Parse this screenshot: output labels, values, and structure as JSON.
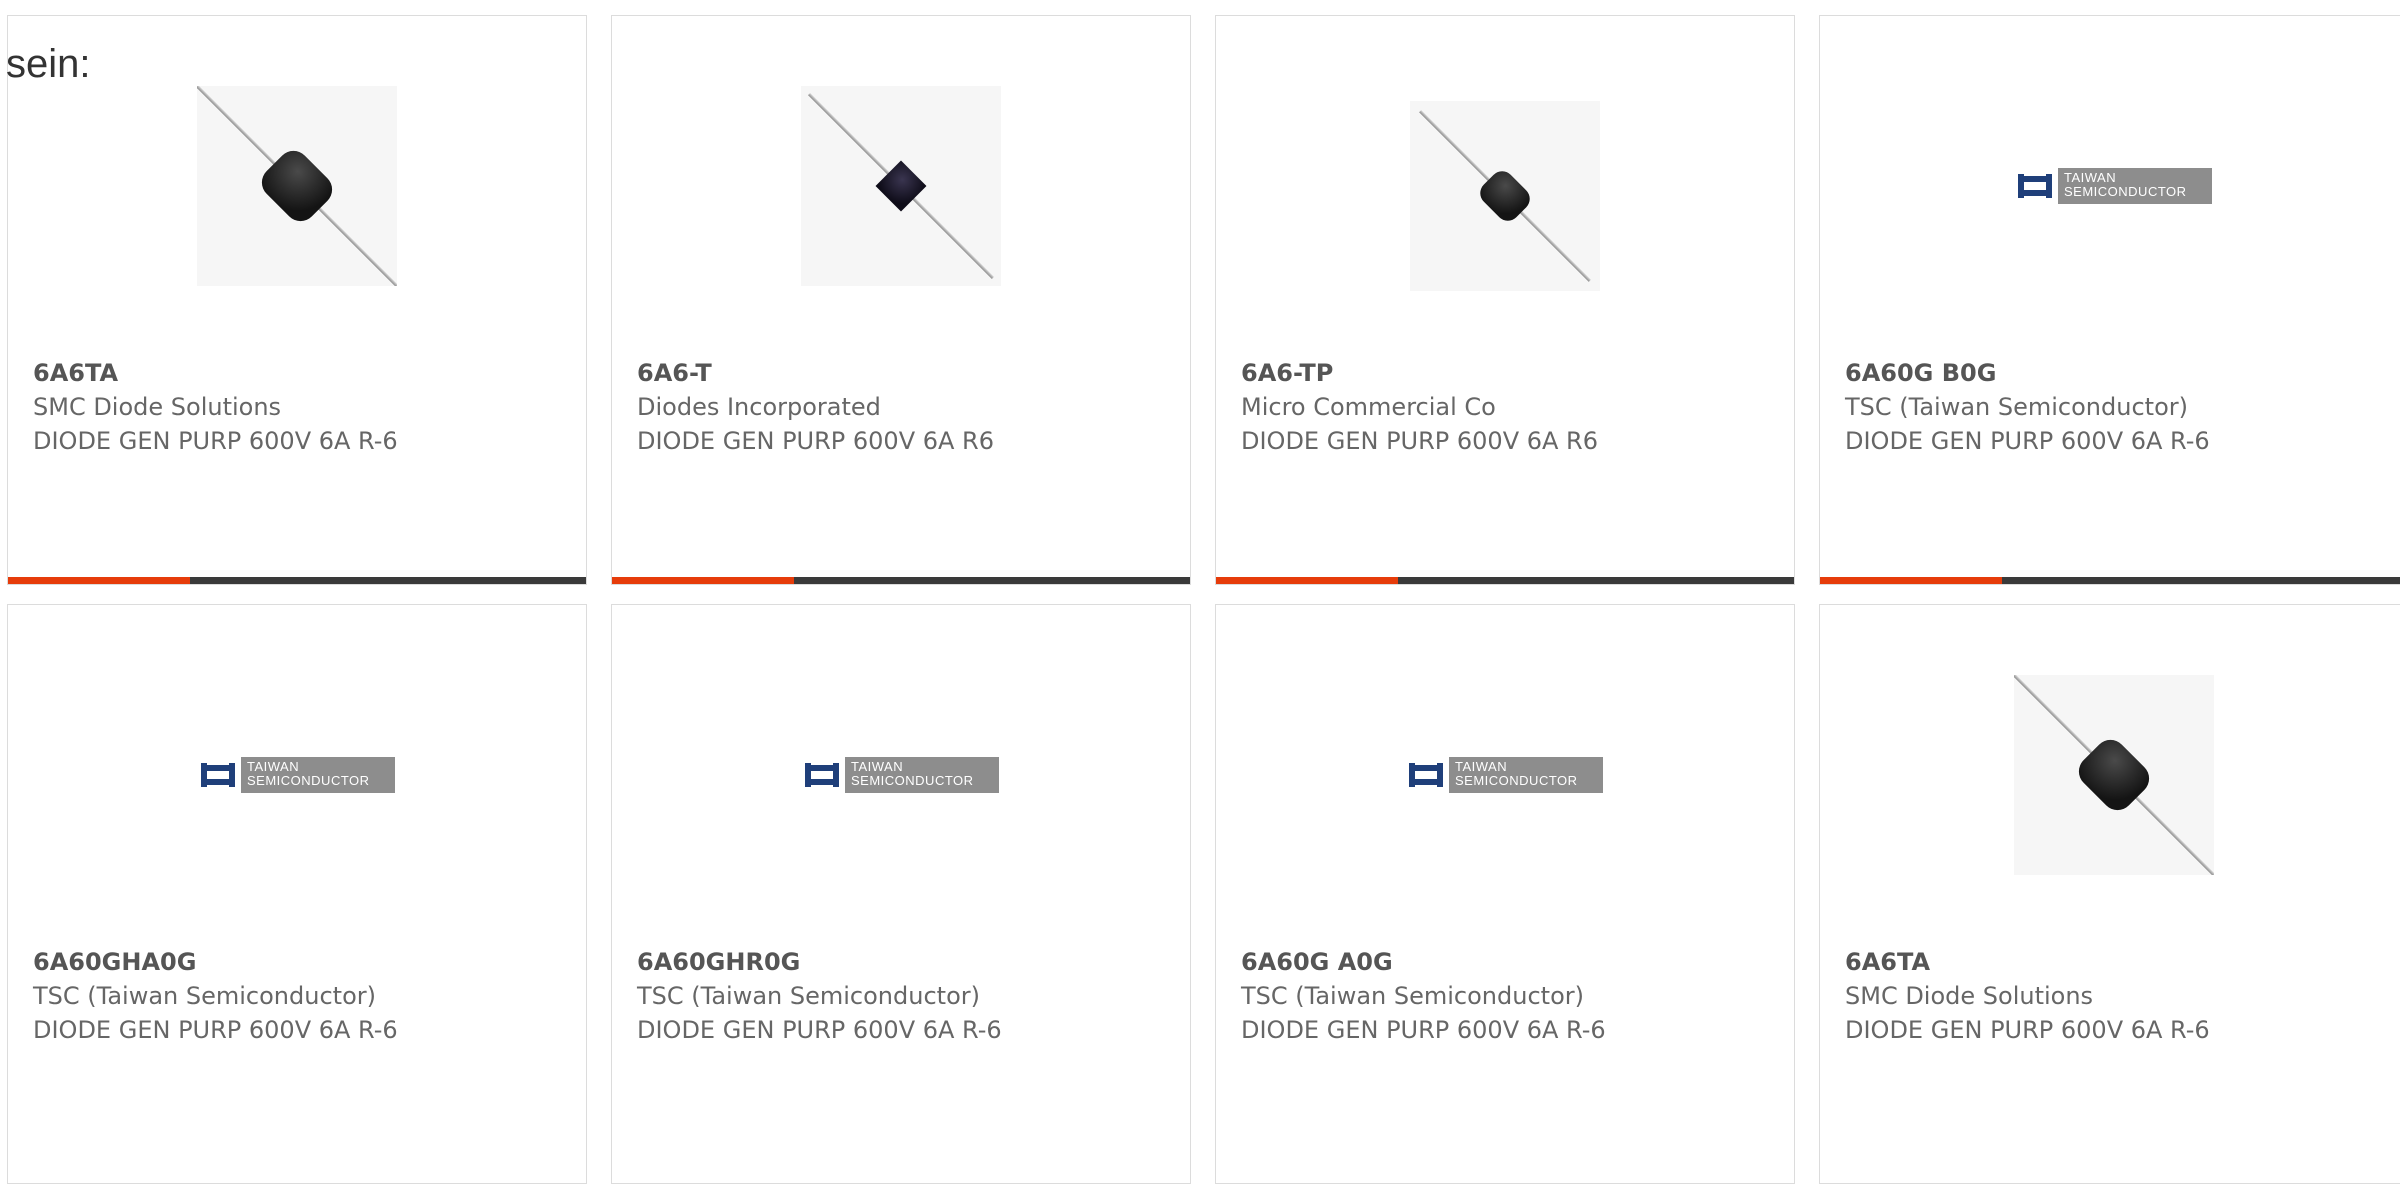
{
  "intro_text": "sein:",
  "accent_color": "#e63c0a",
  "bar_color": "#3a3a3a",
  "products": [
    {
      "part": "6A6TA",
      "manufacturer": "SMC Diode Solutions",
      "description": "DIODE GEN PURP 600V 6A R-6",
      "image": "diode-axial-black-icon"
    },
    {
      "part": "6A6-T",
      "manufacturer": "Diodes Incorporated",
      "description": "DIODE GEN PURP 600V 6A R6",
      "image": "diode-axial-square-icon"
    },
    {
      "part": "6A6-TP",
      "manufacturer": "Micro Commercial Co",
      "description": "DIODE GEN PURP 600V 6A R6",
      "image": "diode-axial-small-icon"
    },
    {
      "part": "6A60G B0G",
      "manufacturer": "TSC (Taiwan Semiconductor)",
      "description": "DIODE GEN PURP 600V 6A R-6",
      "image": "taiwan-semiconductor-logo"
    },
    {
      "part": "6A60GHA0G",
      "manufacturer": "TSC (Taiwan Semiconductor)",
      "description": "DIODE GEN PURP 600V 6A R-6",
      "image": "taiwan-semiconductor-logo"
    },
    {
      "part": "6A60GHR0G",
      "manufacturer": "TSC (Taiwan Semiconductor)",
      "description": "DIODE GEN PURP 600V 6A R-6",
      "image": "taiwan-semiconductor-logo"
    },
    {
      "part": "6A60G A0G",
      "manufacturer": "TSC (Taiwan Semiconductor)",
      "description": "DIODE GEN PURP 600V 6A R-6",
      "image": "taiwan-semiconductor-logo"
    },
    {
      "part": "6A6TA",
      "manufacturer": "SMC Diode Solutions",
      "description": "DIODE GEN PURP 600V 6A R-6",
      "image": "diode-axial-black-icon"
    }
  ],
  "logo_text": [
    "TAIWAN",
    "SEMICONDUCTOR"
  ]
}
